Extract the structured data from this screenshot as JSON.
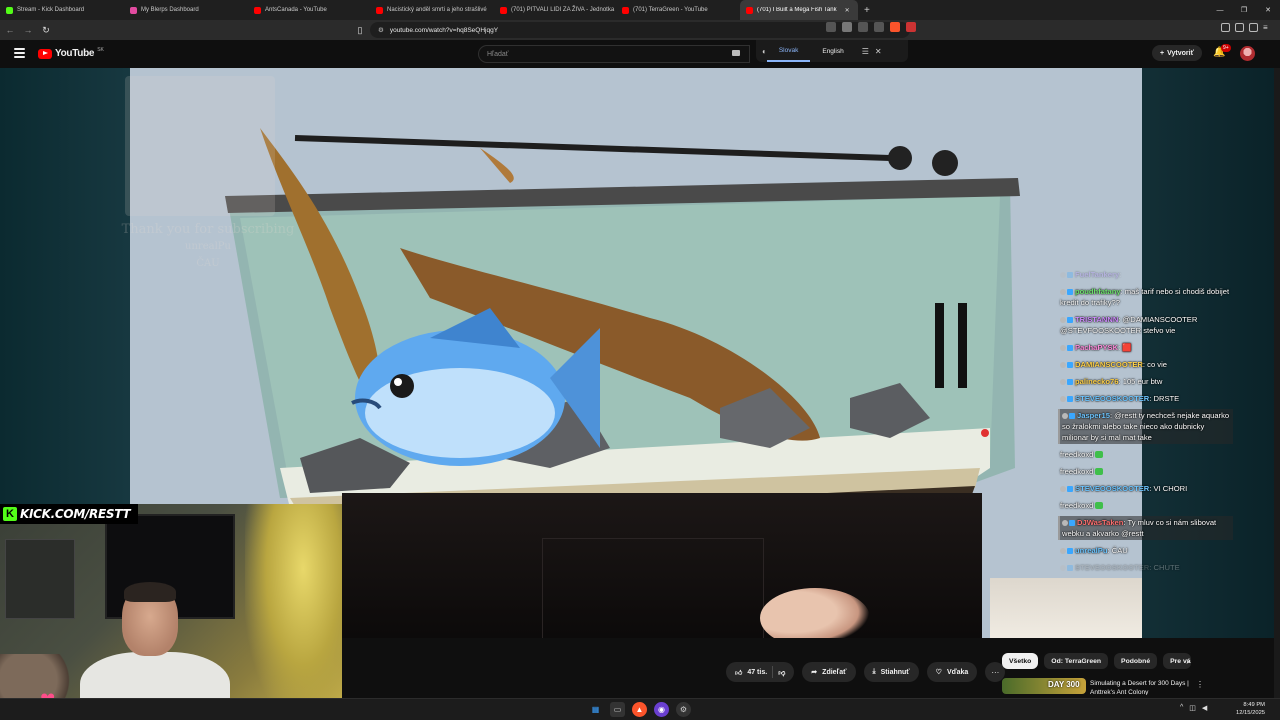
{
  "browser": {
    "tabs": [
      {
        "label": "Stream - Kick Dashboard",
        "color": "#53fc18"
      },
      {
        "label": "My Blerps Dashboard",
        "color": "#e24ba0"
      },
      {
        "label": "AntsCanada - YouTube",
        "color": "#ff0000"
      },
      {
        "label": "Nacistický anděl smrti a jeho strašlivé",
        "color": "#ff0000"
      },
      {
        "label": "(701) PITVALI LIDI ZA ŽIVA - Jednotka",
        "color": "#ff0000"
      },
      {
        "label": "(701) TerraGreen - YouTube",
        "color": "#ff0000"
      },
      {
        "label": "(701) I Built a Mega Fish Tank",
        "color": "#ff0000"
      }
    ],
    "url": "youtube.com/watch?v=hq8SeQHjqgY"
  },
  "youtube": {
    "logo_text": "YouTube",
    "country_code": "SK",
    "search_placeholder": "Hľadať",
    "create_label": "Vytvoriť",
    "notification_count": "9+",
    "translate": {
      "lang1": "Slovak",
      "lang2": "English"
    }
  },
  "stream": {
    "kick_url": "KICK.COM/RESTT",
    "ghost_text": [
      "Thank you for subscribing",
      "unrealPu",
      "ČAU"
    ]
  },
  "chat": [
    {
      "user": "FuelTankery",
      "color": "#b48cff",
      "text": "",
      "faded": true
    },
    {
      "user": "poudhfatany",
      "color": "#6ee36e",
      "text": "maš tarif nebo si chodiš dobijet kredit do trafiky??"
    },
    {
      "user": "TRISTANNN",
      "color": "#d08cff",
      "text": "@DAMIANSCOOTER @STEVFOOSKOOTER stefvo vie"
    },
    {
      "user": "PachaPYSK",
      "color": "#ff8cdc",
      "text": "🟥"
    },
    {
      "user": "DAMIANSCOOTER",
      "color": "#ffd24a",
      "text": "co vie"
    },
    {
      "user": "palinecko76",
      "color": "#ffd24a",
      "text": "105 eur btw"
    },
    {
      "user": "STEVEOOSKOOTER",
      "color": "#6ec6ff",
      "text": "DRSTE"
    },
    {
      "user": "Jasper15",
      "color": "#6ec6ff",
      "text": "@restt ty nechceš nejake aquarko so žralokmi alebo take nieco ako dubnicky milionar by si mal mat take",
      "highlight": true
    },
    {
      "user": "",
      "color": "#fff",
      "text": "freedkoxd"
    },
    {
      "user": "",
      "color": "#fff",
      "text": "freedkoxd"
    },
    {
      "user": "STEVEOOSKOOTER",
      "color": "#6ec6ff",
      "text": "VI CHORI"
    },
    {
      "user": "",
      "color": "#fff",
      "text": "freedkoxd"
    },
    {
      "user": "DJWasTaken",
      "color": "#ff7070",
      "text": "Ty mluv co si nám slibovat webku a akvarko @restt",
      "highlight": true
    },
    {
      "user": "unrealPu",
      "color": "#6ec6ff",
      "text": "ČAU"
    },
    {
      "user": "STEVEOOSKOOTER",
      "color": "#888",
      "text": "CHUTE",
      "faded": true
    }
  ],
  "video_actions": {
    "likes": "47 tis.",
    "share": "Zdieľať",
    "download": "Stiahnuť",
    "thanks": "Vďaka"
  },
  "chips": [
    "Všetko",
    "Od: TerraGreen",
    "Podobné",
    "Pre vás"
  ],
  "recommendation": {
    "thumb_text": "DAY 300",
    "title": "Simulating a Desert for 300 Days | Anttrek's Ant Colony"
  },
  "taskbar": {
    "time": "8:49 PM",
    "date": "12/15/2025"
  }
}
